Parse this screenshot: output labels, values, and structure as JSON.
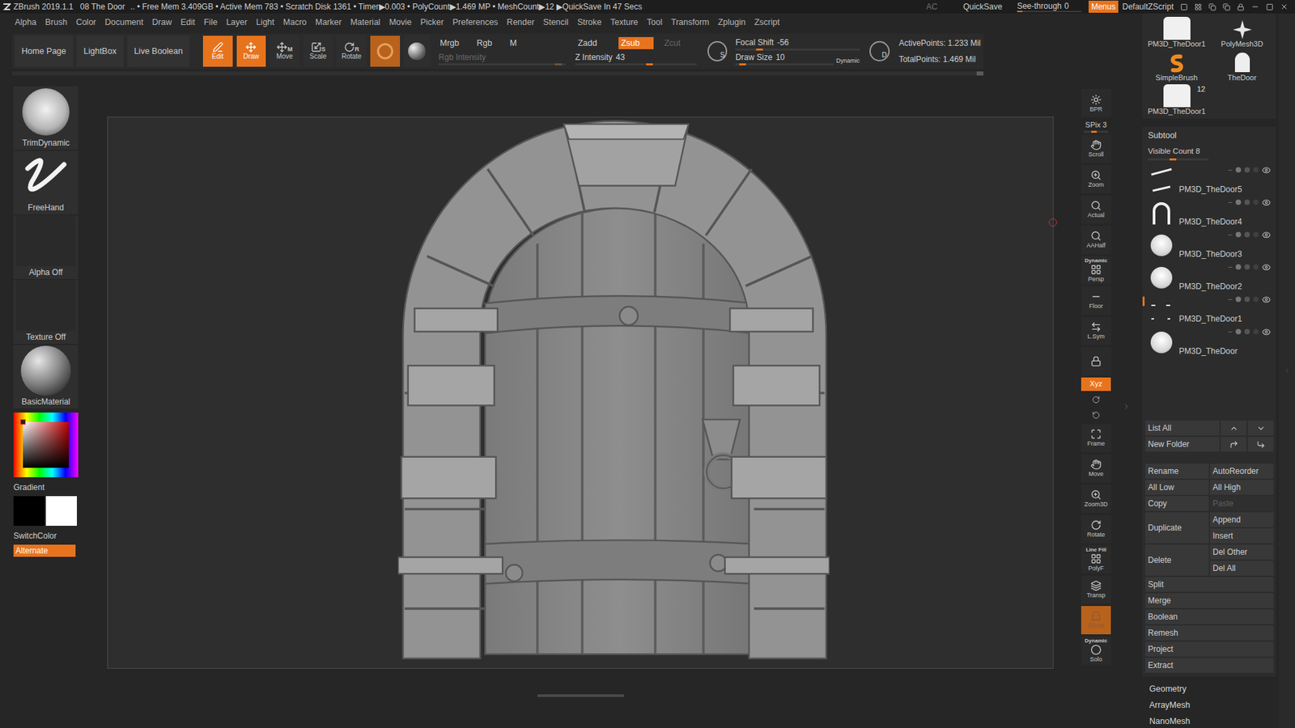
{
  "title_bar": {
    "app": "ZBrush 2019.1.1",
    "document": "08 The Door",
    "status": "..  • Free Mem 3.409GB • Active Mem 783 • Scratch Disk 1361 • Timer▶0.003 • PolyCount▶1.469 MP • MeshCount▶12 ▶QuickSave In 47 Secs",
    "ac": "AC",
    "quicksave": "QuickSave",
    "see_through": {
      "label": "See-through",
      "value": "0",
      "level": 0
    },
    "menus": {
      "label": "Menus",
      "selected": true
    },
    "script": "DefaultZScript"
  },
  "menu_bar": [
    "Alpha",
    "Brush",
    "Color",
    "Document",
    "Draw",
    "Edit",
    "File",
    "Layer",
    "Light",
    "Macro",
    "Marker",
    "Material",
    "Movie",
    "Picker",
    "Preferences",
    "Render",
    "Stencil",
    "Stroke",
    "Texture",
    "Tool",
    "Transform",
    "Zplugin",
    "Zscript"
  ],
  "shelf": {
    "nav": [
      "Home Page",
      "LightBox",
      "Live Boolean"
    ],
    "tools": [
      {
        "label": "Edit",
        "selected": true
      },
      {
        "label": "Draw",
        "selected": true
      },
      {
        "label": "Move",
        "key": "M",
        "selected": false
      },
      {
        "label": "Scale",
        "key": "S",
        "selected": false
      },
      {
        "label": "Rotate",
        "key": "R",
        "selected": false
      }
    ],
    "color_modes": [
      {
        "label": "Mrgb",
        "selected": false
      },
      {
        "label": "Rgb",
        "selected": false
      },
      {
        "label": "M",
        "selected": false
      }
    ],
    "rgb_intensity": {
      "label": "Rgb Intensity",
      "level": 0.97,
      "disabled": true
    },
    "z_modes": [
      {
        "label": "Zadd",
        "selected": false,
        "disabled": false
      },
      {
        "label": "Zsub",
        "selected": true,
        "disabled": false
      },
      {
        "label": "Zcut",
        "selected": false,
        "disabled": true
      }
    ],
    "z_intensity": {
      "label": "Z Intensity",
      "value": "43",
      "level": 0.64
    },
    "s_icon": "S",
    "focal_shift": {
      "label": "Focal Shift",
      "value": "-56",
      "level": 0.22
    },
    "draw_size": {
      "label": "Draw Size",
      "value": "10",
      "level": 0.11,
      "dynamic": "Dynamic"
    },
    "d_icon": "D",
    "stats": [
      "ActivePoints: 1.233 Mil",
      "TotalPoints: 1.469 Mil"
    ]
  },
  "left_shelf": {
    "brush": "TrimDynamic",
    "stroke": "FreeHand",
    "alpha": "Alpha Off",
    "texture": "Texture Off",
    "material": "BasicMaterial",
    "gradient": "Gradient",
    "main_color": "#000000",
    "secondary_color": "#ffffff",
    "switch_color": "SwitchColor",
    "alternate": {
      "label": "Alternate",
      "selected": true
    }
  },
  "right_shelf": [
    {
      "label": "BPR",
      "kind": "button",
      "selected": false
    },
    {
      "label": "SPix 3",
      "kind": "slider",
      "level": 0.3
    },
    {
      "label": "Scroll",
      "kind": "button",
      "selected": false
    },
    {
      "label": "Zoom",
      "kind": "button",
      "selected": false
    },
    {
      "label": "Actual",
      "kind": "button",
      "selected": false
    },
    {
      "label": "AAHalf",
      "kind": "button",
      "selected": false
    },
    {
      "label": "Persp",
      "top": "Dynamic",
      "kind": "button",
      "selected": false
    },
    {
      "label": "Floor",
      "kind": "button",
      "selected": false
    },
    {
      "label": "L.Sym",
      "kind": "button",
      "selected": false
    },
    {
      "kind": "icon",
      "selected": false
    },
    {
      "label": "Xyz",
      "kind": "toggle",
      "selected": true
    },
    {
      "kind": "small",
      "selected": false
    },
    {
      "kind": "small",
      "selected": false
    },
    {
      "label": "Frame",
      "kind": "button",
      "selected": false
    },
    {
      "label": "Move",
      "kind": "button",
      "selected": false
    },
    {
      "label": "Zoom3D",
      "kind": "button",
      "selected": false
    },
    {
      "label": "Rotate",
      "kind": "button",
      "selected": false
    },
    {
      "label": "PolyF",
      "top": "Line Fill",
      "kind": "button",
      "selected": false
    },
    {
      "label": "Transp",
      "kind": "button",
      "selected": false
    },
    {
      "label": "Ghost",
      "kind": "button",
      "selected": true
    },
    {
      "label": "Solo",
      "top": "Dynamic",
      "kind": "button",
      "selected": false
    }
  ],
  "tool_palette": [
    {
      "label": "PM3D_TheDoor1",
      "kind": "door"
    },
    {
      "label": "PolyMesh3D",
      "kind": "star"
    },
    {
      "label": "SimpleBrush",
      "kind": "brush"
    },
    {
      "label": "TheDoor",
      "kind": "doorhalf"
    },
    {
      "label": "PM3D_TheDoor1",
      "kind": "door",
      "count": "12"
    }
  ],
  "subtool": {
    "title": "Subtool",
    "visible_count": {
      "label": "Visible Count 8",
      "level": 0.35
    },
    "rows": [
      {
        "name": "PM3D_TheDoor5",
        "thumb": "strokes",
        "selected": false
      },
      {
        "name": "PM3D_TheDoor4",
        "thumb": "arch",
        "selected": false
      },
      {
        "name": "PM3D_TheDoor3",
        "thumb": "sphere",
        "selected": false
      },
      {
        "name": "PM3D_TheDoor2",
        "thumb": "sphere",
        "selected": false
      },
      {
        "name": "PM3D_TheDoor1",
        "thumb": "dashes",
        "selected": true
      },
      {
        "name": "PM3D_TheDoor",
        "thumb": "sphere",
        "selected": false
      }
    ],
    "list_all": "List All",
    "new_folder": "New Folder",
    "buttons": [
      [
        {
          "label": "Rename",
          "disabled": false
        },
        {
          "label": "AutoReorder",
          "disabled": false
        }
      ],
      [
        {
          "label": "All Low",
          "disabled": false
        },
        {
          "label": "All High",
          "disabled": false
        }
      ],
      [
        {
          "label": "Copy",
          "disabled": false
        },
        {
          "label": "Paste",
          "disabled": true
        }
      ]
    ],
    "duplicate": "Duplicate",
    "append": "Append",
    "insert": "Insert",
    "delete": "Delete",
    "del_other": "Del Other",
    "del_all": "Del All",
    "actions": [
      "Split",
      "Merge",
      "Boolean",
      "Remesh",
      "Project",
      "Extract"
    ]
  },
  "sub_palettes": [
    "Geometry",
    "ArrayMesh",
    "NanoMesh"
  ]
}
